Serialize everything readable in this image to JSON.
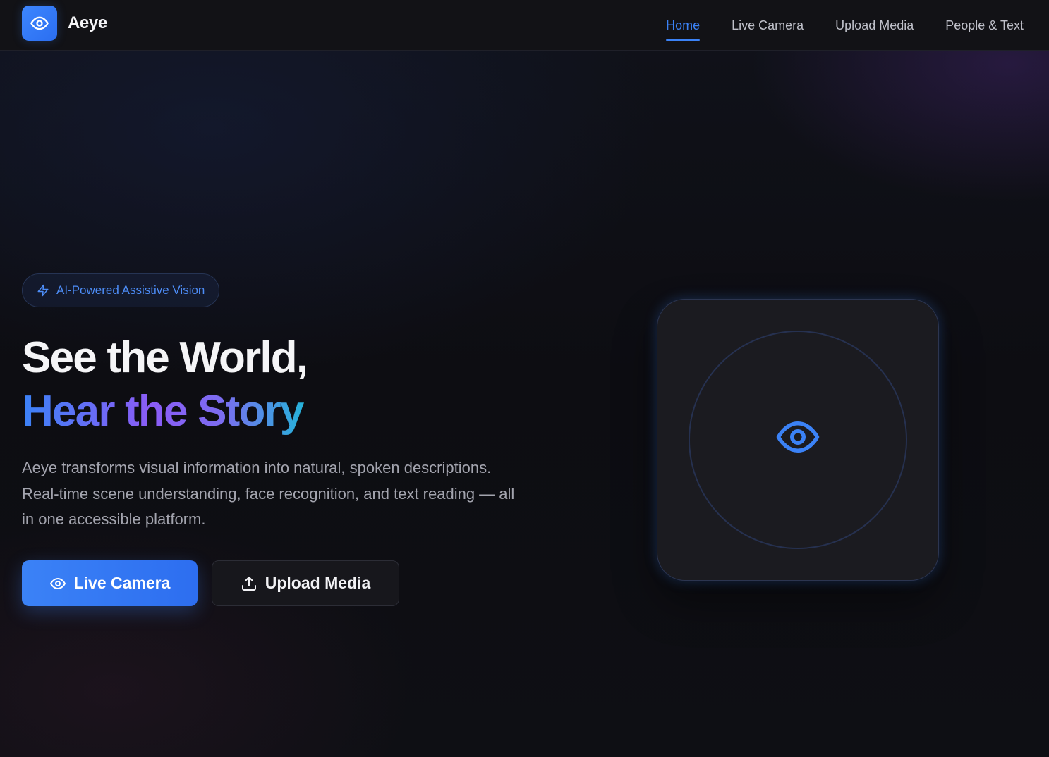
{
  "app": {
    "name": "Aeye",
    "logo_icon": "eye-icon"
  },
  "nav": {
    "items": [
      {
        "label": "Home",
        "active": true
      },
      {
        "label": "Live Camera",
        "active": false
      },
      {
        "label": "Upload Media",
        "active": false
      },
      {
        "label": "People & Text",
        "active": false
      }
    ]
  },
  "hero": {
    "badge": {
      "icon": "lightning-bolt-icon",
      "label": "AI-Powered Assistive Vision"
    },
    "headline": {
      "line1": "See the World,",
      "line2": "Hear the Story"
    },
    "description": "Aeye transforms visual information into natural, spoken descriptions. Real-time scene understanding, face recognition, and text reading — all in one accessible platform.",
    "buttons": {
      "primary": {
        "icon": "eye-icon",
        "label": "Live Camera"
      },
      "secondary": {
        "icon": "upload-icon",
        "label": "Upload Media"
      }
    },
    "visual": {
      "icon": "eye-icon"
    }
  },
  "colors": {
    "accent": "#3b82f6",
    "background": "#0c0c10",
    "header_background": "#121216",
    "gradient_text": [
      "#3b82f6",
      "#8b5cf6",
      "#22b5d9"
    ]
  }
}
